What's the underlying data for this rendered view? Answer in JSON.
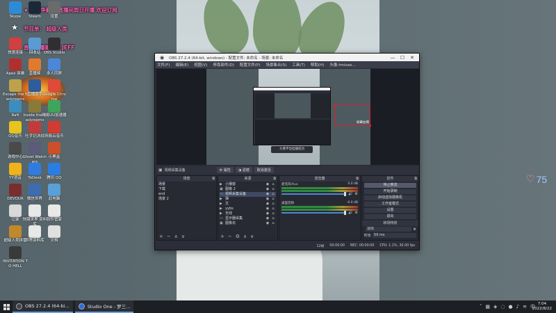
{
  "overlay": {
    "line1": "★ 平台争霸赛 直播间周日开播 欢迎订阅",
    "line2": "节目单： 超级人类",
    "line3": "直播主播昵称： JEFF"
  },
  "desktop_icons": [
    {
      "label": "Skype",
      "color": "#2d8bd6"
    },
    {
      "label": "Steam",
      "color": "#1b2838"
    },
    {
      "label": "设置",
      "color": "#6b6b6b"
    },
    {
      "label": "快速连接",
      "color": "#d04040"
    },
    {
      "label": "回收站",
      "color": "#5a9bd4"
    },
    {
      "label": "OBS Studio",
      "color": "#302e31"
    },
    {
      "label": "Apex 英雄",
      "color": "#b03030"
    },
    {
      "label": "直播姬",
      "color": "#e07a2e"
    },
    {
      "label": "多人同屏",
      "color": "#4b87d6"
    },
    {
      "label": "Escape the Backrooms",
      "color": "#bda24c"
    },
    {
      "label": "直播助手",
      "color": "#2e5d9b"
    },
    {
      "label": "Google Chrome",
      "color": "#dd4b39"
    },
    {
      "label": "Raft",
      "color": "#3c8dbc"
    },
    {
      "label": "Inside the Backrooms",
      "color": "#8a7a3a"
    },
    {
      "label": "网易UU加速器",
      "color": "#3fa55a"
    },
    {
      "label": "QQ音乐",
      "color": "#e7c51e"
    },
    {
      "label": "吐字记决战",
      "color": "#c23b3b"
    },
    {
      "label": "网易云音乐",
      "color": "#d33a31"
    },
    {
      "label": "游戏中心",
      "color": "#4a4a4a"
    },
    {
      "label": "Ghost Watchers",
      "color": "#5c5c7a"
    },
    {
      "label": "小黑盒",
      "color": "#cc4f2c"
    },
    {
      "label": "YY语音",
      "color": "#f0b31a"
    },
    {
      "label": "ToDesk",
      "color": "#2f7be0"
    },
    {
      "label": "腾讯 QQ",
      "color": "#2a7de1"
    },
    {
      "label": "DEVOUR",
      "color": "#7a2d2d"
    },
    {
      "label": "微信世界",
      "color": "#3d6db0"
    },
    {
      "label": "此电脑",
      "color": "#5aa0d8"
    },
    {
      "label": "记录",
      "color": "#d8d8d8"
    },
    {
      "label": "快路世界 资料库",
      "color": "#e8e8e8"
    },
    {
      "label": "软件管家",
      "color": "#e8e8e8"
    },
    {
      "label": "超级人类拼雷",
      "color": "#c08a2c"
    },
    {
      "label": "世界资料库",
      "color": "#e8e8e8"
    },
    {
      "label": "文档",
      "color": "#e0e0e0"
    },
    {
      "label": "INVITATION TO HELL",
      "color": "#3a3a3a"
    }
  ],
  "obs": {
    "title": "OBS 27.2.4 (64-bit, windows) - 配置文件: 未命名 - 场景: 未命名",
    "menu": [
      "文件(F)",
      "编辑(E)",
      "视图(V)",
      "停靠部件(D)",
      "配置文件(P)",
      "场景集合(S)",
      "工具(T)",
      "帮助(H)",
      "头像-tmixao..."
    ],
    "preview_label": "屏幕右侧",
    "preview_toast": "头像平台挂播成功",
    "source_name": "视频采集设备",
    "toolbar_buttons": [
      "⚙ 属性",
      "◑ 滤镜",
      "取消激活"
    ],
    "scenes": {
      "title": "场景",
      "items": [
        "场景",
        "下载",
        "end",
        "场景 2"
      ]
    },
    "sources": {
      "title": "来源",
      "items": [
        {
          "icon": "▶",
          "name": "小播窗"
        },
        {
          "icon": "▣",
          "name": "图像 2"
        },
        {
          "icon": "▭",
          "name": "视频采集设备"
        },
        {
          "icon": "▶",
          "name": "弹"
        },
        {
          "icon": "▶",
          "name": "文"
        },
        {
          "icon": "▶",
          "name": "yybs"
        },
        {
          "icon": "▶",
          "name": "无线"
        },
        {
          "icon": "▭",
          "name": "显示器采集"
        },
        {
          "icon": "▣",
          "name": "图像充"
        }
      ]
    },
    "mixer": {
      "title": "混音器",
      "channels": [
        {
          "name": "麦克风/Aux",
          "db": "0.0 dB"
        },
        {
          "name": "桌面音频",
          "db": "-0.0 dB"
        }
      ]
    },
    "controls": {
      "title": "控件",
      "buttons": [
        "停止推流",
        "开始录制",
        "启动虚拟摄像机",
        "工作室模式",
        "设置",
        "退出"
      ]
    },
    "transitions": {
      "title": "转场特效",
      "type": "淡出",
      "duration_label": "时长",
      "duration": "50 ms"
    },
    "status": [
      "12帧",
      "00:00:00",
      "REC: 00:00:00",
      "CPU: 1.1%, 30.00 fps"
    ]
  },
  "viewers": {
    "count": "75"
  },
  "taskbar": {
    "tasks": [
      "OBS 27.2.4 (64-bi...",
      "Studio One - 罗三..."
    ],
    "time": "7:04",
    "date": "2022/8/22"
  }
}
